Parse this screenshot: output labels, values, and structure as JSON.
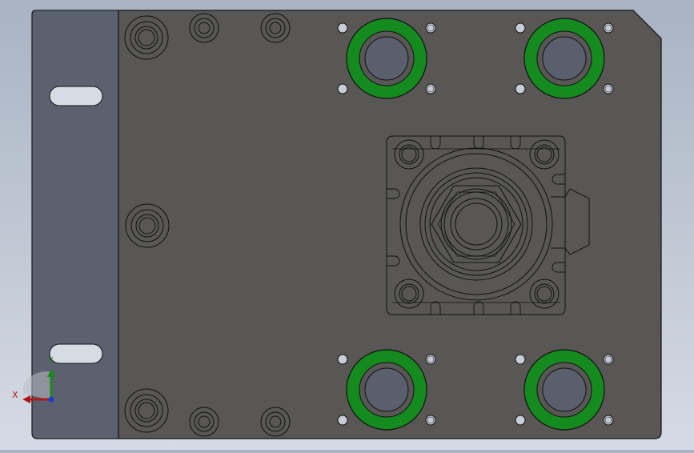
{
  "viewport": {
    "background_top": "#a9b3c3",
    "background_bottom": "#d5dbe4"
  },
  "triad": {
    "x_label": "X",
    "y_label": "Y",
    "x_color": "#b01818",
    "y_color": "#1a8a1a",
    "z_color": "#1a3cc8"
  },
  "colors": {
    "plate_face": "#585755",
    "side_strip": "#5c6170",
    "edge": "#111111",
    "bore": "#5a5f6e",
    "bushing_ring": "#148a1f",
    "slot_fill": "#d7dce4",
    "small_hole_fill": "#c7ccd6"
  },
  "icons": [
    "coordinate-triad-icon"
  ]
}
